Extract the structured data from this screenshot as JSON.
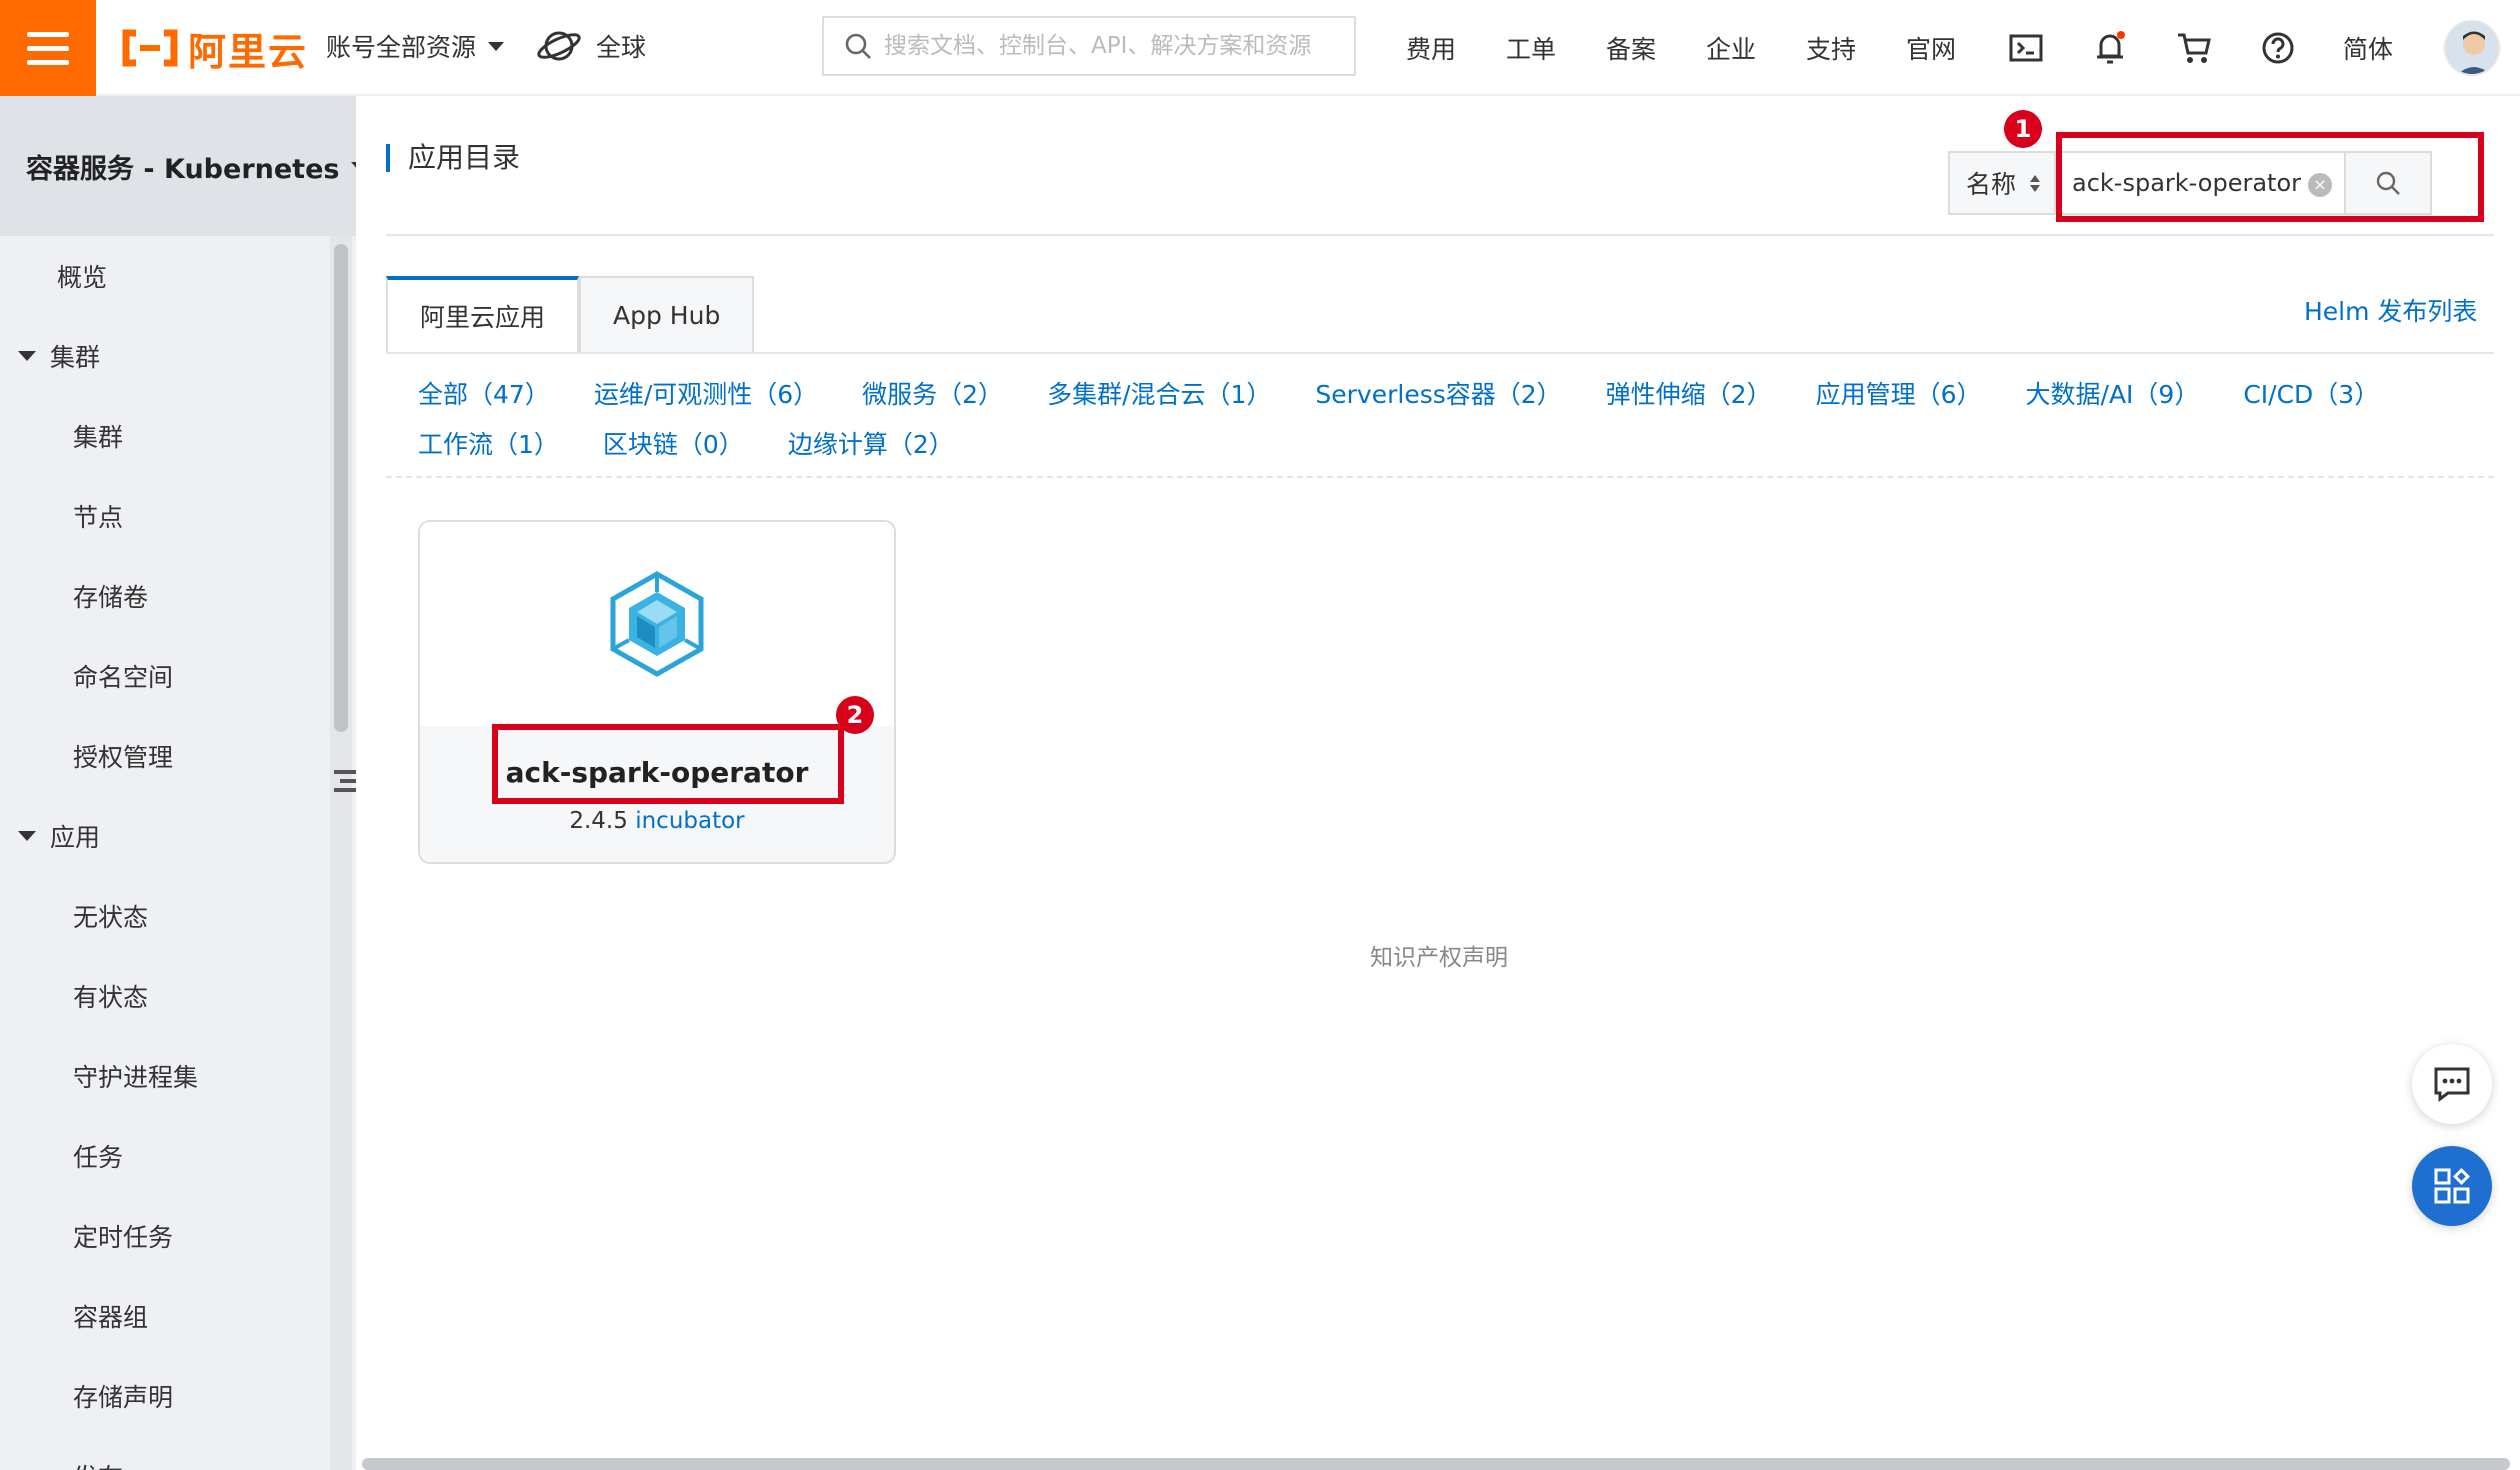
{
  "topbar": {
    "logo_text": "阿里云",
    "resource_selector": "账号全部资源",
    "region": "全球",
    "search_placeholder": "搜索文档、控制台、API、解决方案和资源",
    "nav": [
      "费用",
      "工单",
      "备案",
      "企业",
      "支持",
      "官网"
    ],
    "language": "简体"
  },
  "sidebar": {
    "product_title": "容器服务 - Kubernetes",
    "items": [
      {
        "label": "概览",
        "type": "top"
      },
      {
        "label": "集群",
        "type": "group"
      },
      {
        "label": "集群",
        "type": "child"
      },
      {
        "label": "节点",
        "type": "child"
      },
      {
        "label": "存储卷",
        "type": "child"
      },
      {
        "label": "命名空间",
        "type": "child"
      },
      {
        "label": "授权管理",
        "type": "child"
      },
      {
        "label": "应用",
        "type": "group"
      },
      {
        "label": "无状态",
        "type": "child"
      },
      {
        "label": "有状态",
        "type": "child"
      },
      {
        "label": "守护进程集",
        "type": "child"
      },
      {
        "label": "任务",
        "type": "child"
      },
      {
        "label": "定时任务",
        "type": "child"
      },
      {
        "label": "容器组",
        "type": "child"
      },
      {
        "label": "存储声明",
        "type": "child"
      },
      {
        "label": "发布",
        "type": "child"
      }
    ]
  },
  "main": {
    "page_title": "应用目录",
    "search": {
      "field_label": "名称",
      "value": "ack-spark-operator"
    },
    "tabs": [
      "阿里云应用",
      "App Hub"
    ],
    "helm_link": "Helm 发布列表",
    "categories": [
      "全部（47）",
      "运维/可观测性（6）",
      "微服务（2）",
      "多集群/混合云（1）",
      "Serverless容器（2）",
      "弹性伸缩（2）",
      "应用管理（6）",
      "大数据/AI（9）",
      "CI/CD（3）",
      "工作流（1）",
      "区块链（0）",
      "边缘计算（2）"
    ],
    "card": {
      "name": "ack-spark-operator",
      "version": "2.4.5",
      "repo": "incubator"
    },
    "footer": "知识产权声明"
  },
  "annotations": {
    "step1": "1",
    "step2": "2",
    "color": "#d9001b"
  },
  "colors": {
    "brand": "#ff6a00",
    "link": "#0070cc",
    "float_button": "#1f6fd1"
  }
}
